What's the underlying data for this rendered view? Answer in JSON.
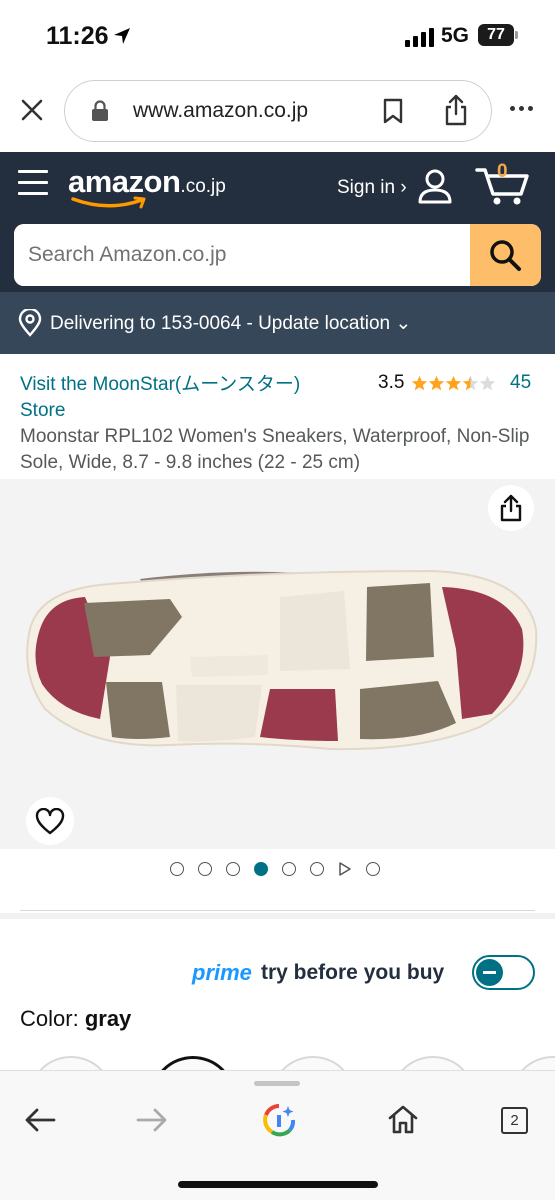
{
  "status_bar": {
    "time": "11:26",
    "network": "5G",
    "battery": "77"
  },
  "browser": {
    "url": "www.amazon.co.jp"
  },
  "header": {
    "logo": "amazon",
    "logo_suffix": ".co.jp",
    "signin_label": "Sign in ›",
    "cart_count": "0",
    "search_placeholder": "Search Amazon.co.jp"
  },
  "delivery": {
    "text": "Delivering to 153-0064 - Update location ⌄"
  },
  "product": {
    "store_link": "Visit the MoonStar(ムーンスター) Store",
    "rating": "3.5",
    "rating_value": 3.5,
    "rating_count": "45",
    "title": "Moonstar RPL102 Women's Sneakers, Waterproof, Non-Slip Sole, Wide, 8.7 - 9.8 inches (22 - 25 cm)"
  },
  "gallery": {
    "total_items": 8,
    "active_index": 3,
    "video_index": 6
  },
  "prime": {
    "brand": "prime",
    "label": "try before you buy",
    "toggle_on": false
  },
  "color": {
    "label": "Color:",
    "value": "gray"
  },
  "toolbar": {
    "tab_count": "2"
  },
  "colors": {
    "link": "#007185",
    "header_bg": "#232f3e",
    "deliver_bg": "#37475a",
    "search_btn": "#febd69",
    "star": "#ffa41c",
    "prime": "#1a98ff"
  }
}
